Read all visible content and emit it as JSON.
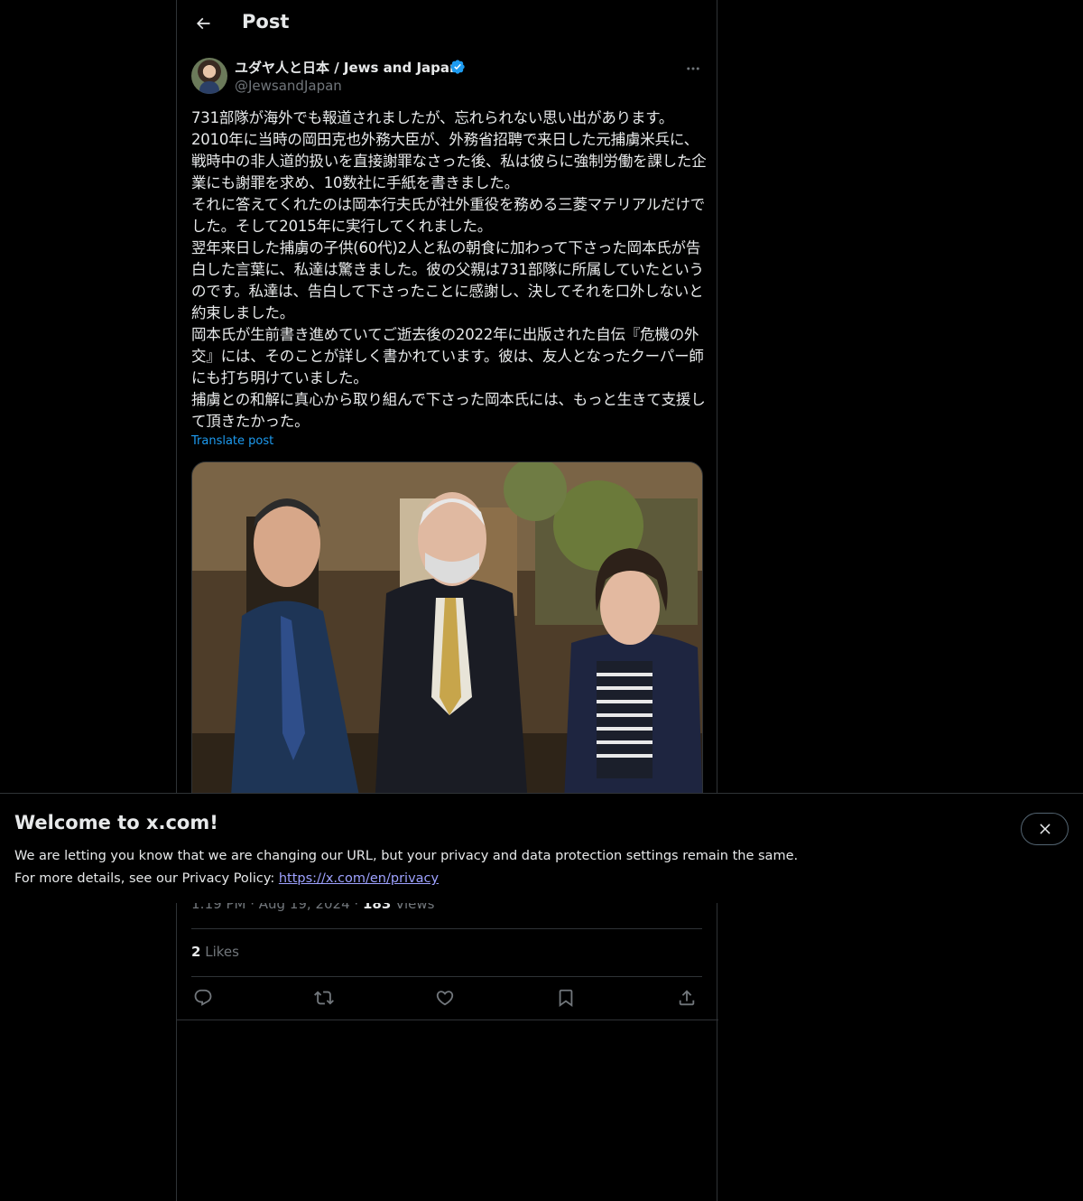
{
  "header": {
    "title": "Post"
  },
  "author": {
    "display_name": "ユダヤ人と日本 / Jews and Japan",
    "handle": "@JewsandJapan",
    "verified": true
  },
  "post": {
    "text": "731部隊が海外でも報道されましたが、忘れられない思い出があります。\n2010年に当時の岡田克也外務大臣が、外務省招聘で来日した元捕虜米兵に、戦時中の非人道的扱いを直接謝罪なさった後、私は彼らに強制労働を課した企業にも謝罪を求め、10数社に手紙を書きました。\nそれに答えてくれたのは岡本行夫氏が社外重役を務める三菱マテリアルだけでした。そして2015年に実行してくれました。\n翌年来日した捕虜の子供(60代)2人と私の朝食に加わって下さった岡本氏が告白した言葉に、私達は驚きました。彼の父親は731部隊に所属していたというのです。私達は、告白して下さったことに感謝し、決してそれを口外しないと約束しました。\n岡本氏が生前書き進めていてご逝去後の2022年に出版された自伝『危機の外交』には、そのことが詳しく書かれています。彼は、友人となったクーパー師にも打ち明けていました。\n捕虜との和解に真心から取り組んで下さった岡本氏には、もっと生きて支援して頂きたかった。",
    "translate_label": "Translate post",
    "time": "1:19 PM",
    "date": "Aug 19, 2024",
    "views_count": "183",
    "views_label": "Views",
    "likes_count": "2",
    "likes_label": "Likes"
  },
  "actions": [
    "reply",
    "repost",
    "like",
    "bookmark",
    "share"
  ],
  "banner": {
    "title": "Welcome to x.com!",
    "line1": "We are letting you know that we are changing our URL, but your privacy and data protection settings remain the same.",
    "line2_prefix": "For more details, see our Privacy Policy: ",
    "link": "https://x.com/en/privacy"
  },
  "colors": {
    "background": "#000000",
    "text": "#e7e9ea",
    "secondary": "#71767b",
    "accent": "#1d9bf0",
    "border": "#2f3336"
  }
}
